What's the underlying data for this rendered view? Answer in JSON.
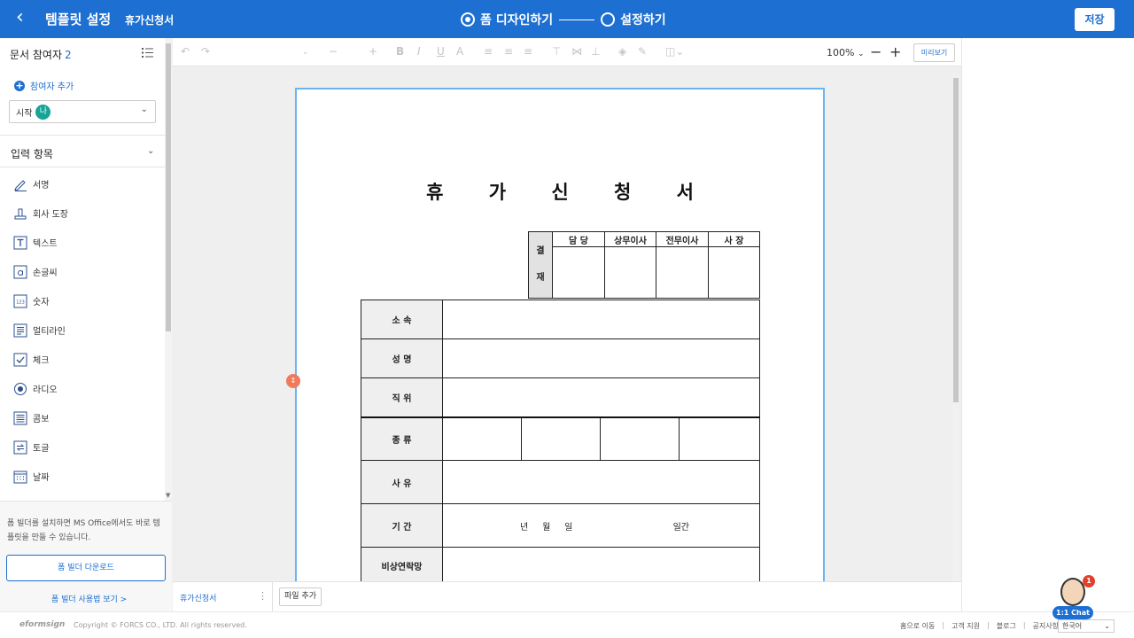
{
  "header": {
    "title": "템플릿 설정",
    "document_name": "휴가신청서",
    "steps": [
      {
        "label": "폼 디자인하기",
        "active": true
      },
      {
        "label": "설정하기",
        "active": false
      }
    ],
    "save_label": "저장"
  },
  "sidebar": {
    "participants_label": "문서 참여자",
    "participants_count": "2",
    "add_participant_label": "참여자 추가",
    "participant_select": {
      "label": "시작",
      "avatar": "나"
    },
    "input_section_label": "입력 항목",
    "items": [
      {
        "label": "서명",
        "icon": "signature-icon"
      },
      {
        "label": "회사 도장",
        "icon": "stamp-icon"
      },
      {
        "label": "텍스트",
        "icon": "text-icon"
      },
      {
        "label": "손글씨",
        "icon": "handwriting-icon"
      },
      {
        "label": "숫자",
        "icon": "number-icon"
      },
      {
        "label": "멀티라인",
        "icon": "multiline-icon"
      },
      {
        "label": "체크",
        "icon": "checkbox-icon"
      },
      {
        "label": "라디오",
        "icon": "radio-icon"
      },
      {
        "label": "콤보",
        "icon": "combo-icon"
      },
      {
        "label": "토글",
        "icon": "toggle-icon"
      },
      {
        "label": "날짜",
        "icon": "date-icon"
      }
    ],
    "promo_text": "폼 빌더를 설치하면 MS Office에서도 바로 템플릿을 만들 수 있습니다.",
    "promo_button": "폼 빌더 다운로드",
    "promo_link": "폼 빌더 사용법 보기 >"
  },
  "toolbar": {
    "zoom": "100%",
    "preview_label": "미리보기"
  },
  "document": {
    "heading": "휴 가 신 청 서",
    "approval": {
      "side_label_1": "결",
      "side_label_2": "재",
      "columns": [
        "담  당",
        "상무이사",
        "전무이사",
        "사  장"
      ]
    },
    "rows": [
      {
        "label": "소    속"
      },
      {
        "label": "성    명"
      },
      {
        "label": "직    위"
      },
      {
        "label": "종    류"
      },
      {
        "label": "사    유"
      },
      {
        "label": "기    간"
      },
      {
        "label": "비상연락망"
      }
    ],
    "period_text": "년     월     일",
    "period_suffix": "일간"
  },
  "bottom": {
    "tab_name": "휴가신청서",
    "file_add_label": "파일 추가"
  },
  "footer": {
    "logo": "eformsign",
    "copyright": "Copyright © FORCS CO., LTD. All rights reserved.",
    "links": [
      "홈으로 이동",
      "고객 지원",
      "블로그",
      "공지사항"
    ],
    "language": "한국어"
  },
  "chat": {
    "label": "1:1 Chat",
    "badge": "1"
  }
}
